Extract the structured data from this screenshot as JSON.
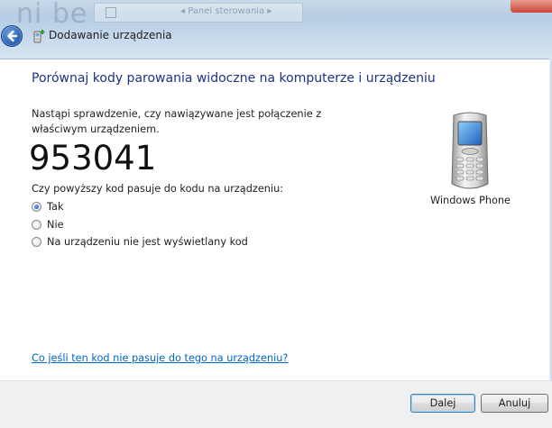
{
  "window": {
    "title": "Dodawanie urządzenia",
    "background_text": "ni be",
    "background_breadcrumb": "◂ Panel sterowania ▸"
  },
  "content": {
    "heading": "Porównaj kody parowania widoczne na komputerze i urządzeniu",
    "description": "Nastąpi sprawdzenie, czy nawiązywane jest połączenie z właściwym urządzeniem.",
    "pairing_code": "953041",
    "question": "Czy powyższy kod pasuje do kodu na urządzeniu:",
    "options": [
      {
        "label": "Tak",
        "checked": true
      },
      {
        "label": "Nie",
        "checked": false
      },
      {
        "label": "Na urządzeniu nie jest wyświetlany kod",
        "checked": false
      }
    ],
    "device_name": "Windows Phone",
    "help_link": "Co jeśli ten kod nie pasuje do tego na urządzeniu?"
  },
  "footer": {
    "next_label": "Dalej",
    "cancel_label": "Anuluj"
  },
  "icons": {
    "back": "back-arrow-icon",
    "title": "add-device-icon",
    "device": "mobile-phone-icon"
  },
  "colors": {
    "heading": "#1e3287",
    "link": "#0066cc",
    "footer_bg": "#f0f0f0",
    "accent_button_border": "#3c7fb1"
  }
}
